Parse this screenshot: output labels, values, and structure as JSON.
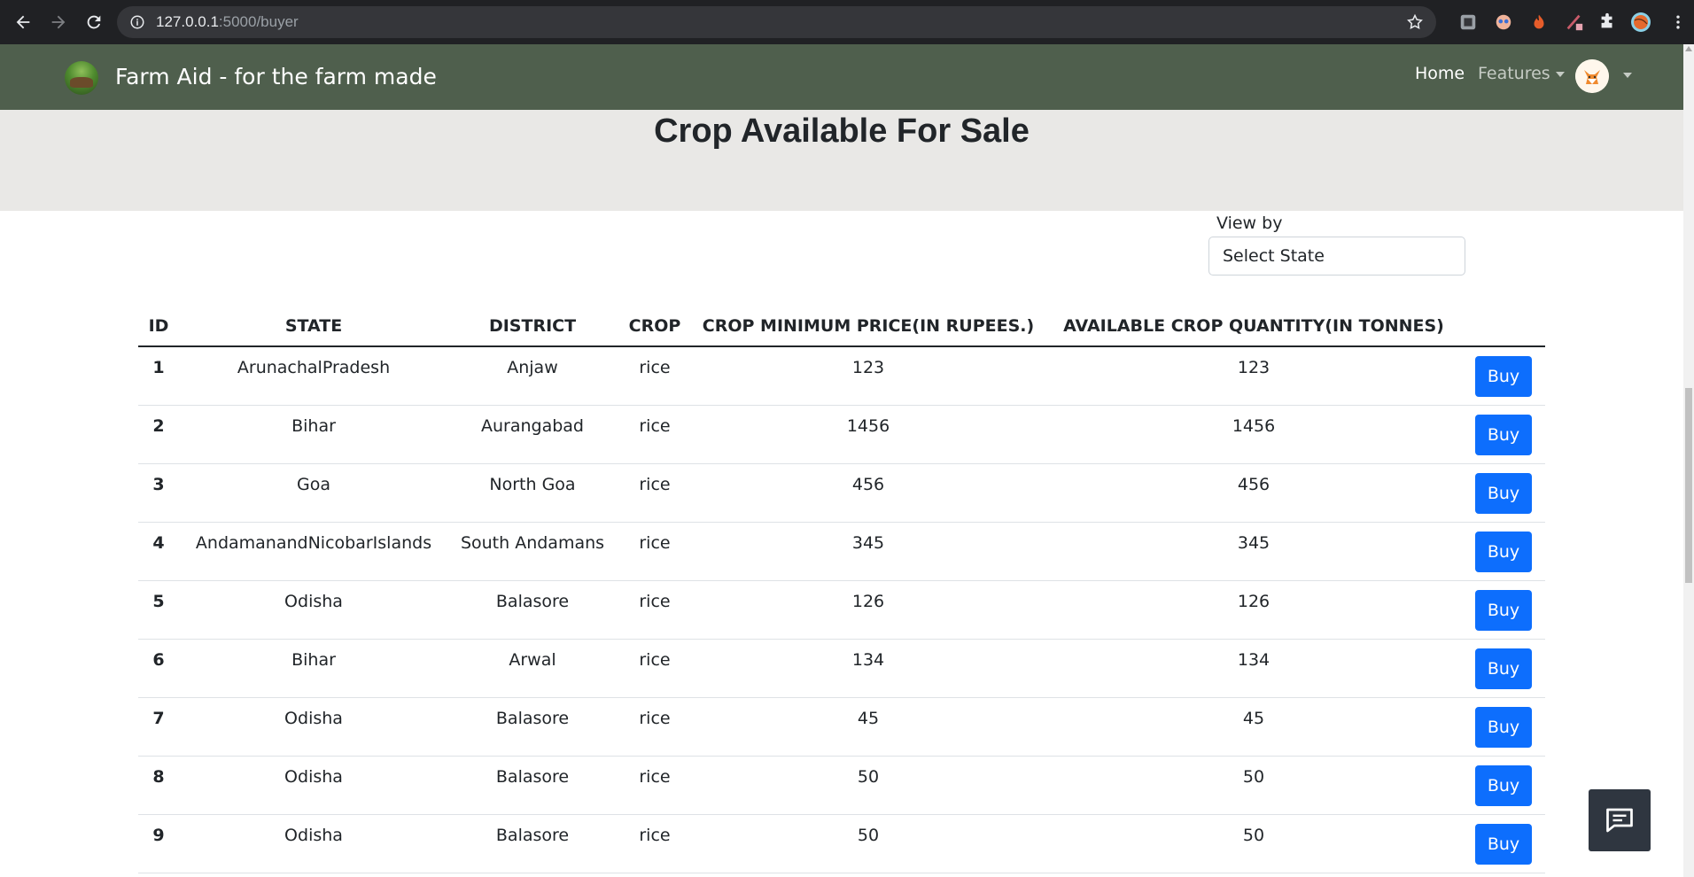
{
  "browser": {
    "url_host": "127.0.0.1",
    "url_path": ":5000/buyer"
  },
  "navbar": {
    "brand": "Farm Aid - for the farm made",
    "home": "Home",
    "features": "Features"
  },
  "page": {
    "title": "Crop Available For Sale"
  },
  "filter": {
    "label": "View by",
    "select_value": "Select State"
  },
  "table": {
    "headers": [
      "ID",
      "STATE",
      "DISTRICT",
      "CROP",
      "CROP MINIMUM PRICE(IN RUPEES.)",
      "AVAILABLE CROP QUANTITY(IN TONNES)"
    ],
    "buy_label": "Buy",
    "rows": [
      {
        "id": "1",
        "state": "ArunachalPradesh",
        "district": "Anjaw",
        "crop": "rice",
        "price": "123",
        "quantity": "123"
      },
      {
        "id": "2",
        "state": "Bihar",
        "district": "Aurangabad",
        "crop": "rice",
        "price": "1456",
        "quantity": "1456"
      },
      {
        "id": "3",
        "state": "Goa",
        "district": "North Goa",
        "crop": "rice",
        "price": "456",
        "quantity": "456"
      },
      {
        "id": "4",
        "state": "AndamanandNicobarIslands",
        "district": "South Andamans",
        "crop": "rice",
        "price": "345",
        "quantity": "345"
      },
      {
        "id": "5",
        "state": "Odisha",
        "district": "Balasore",
        "crop": "rice",
        "price": "126",
        "quantity": "126"
      },
      {
        "id": "6",
        "state": "Bihar",
        "district": "Arwal",
        "crop": "rice",
        "price": "134",
        "quantity": "134"
      },
      {
        "id": "7",
        "state": "Odisha",
        "district": "Balasore",
        "crop": "rice",
        "price": "45",
        "quantity": "45"
      },
      {
        "id": "8",
        "state": "Odisha",
        "district": "Balasore",
        "crop": "rice",
        "price": "50",
        "quantity": "50"
      },
      {
        "id": "9",
        "state": "Odisha",
        "district": "Balasore",
        "crop": "rice",
        "price": "50",
        "quantity": "50"
      }
    ]
  },
  "colors": {
    "navbar_bg": "#4f5f4d",
    "jumbotron_bg": "#e9e8e6",
    "buy_button": "#0d6efd",
    "chat_widget": "#2f3640"
  },
  "icons": {
    "back": "arrow-left-icon",
    "forward": "arrow-right-icon",
    "reload": "reload-icon",
    "info": "info-icon",
    "star": "star-icon",
    "extensions": "puzzle-icon",
    "menu": "kebab-menu-icon",
    "chat": "chat-bubble-icon"
  }
}
